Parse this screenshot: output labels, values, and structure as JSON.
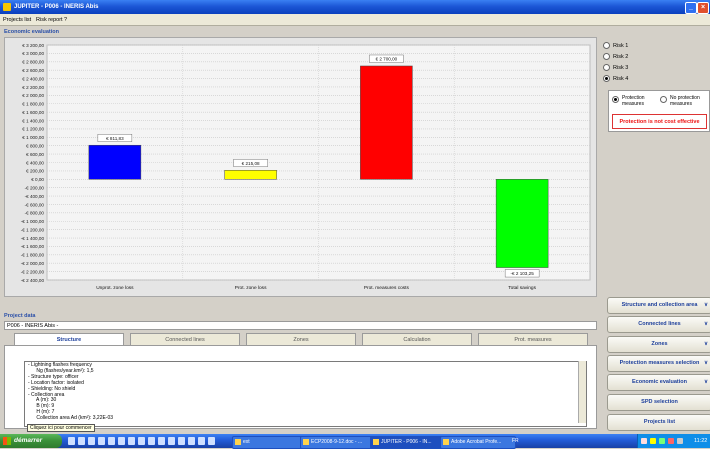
{
  "window": {
    "title": "JUPITER - P006 - INERIS Abis",
    "colors": {
      "title_bar": "#245edb",
      "accent": "#1d3f9b",
      "warning": "#e11111"
    }
  },
  "menu": {
    "items": [
      "Projects list",
      "Risk report",
      "?"
    ]
  },
  "economic_evaluation": {
    "title": "Economic evaluation",
    "chart_data": {
      "type": "bar",
      "title": "",
      "xlabel": "",
      "ylabel": "",
      "ylim": [
        -2400,
        3200
      ],
      "grid": true,
      "yticks": [
        "€ 3 200,00",
        "€ 3 000,00",
        "€ 2 800,00",
        "€ 2 600,00",
        "€ 2 400,00",
        "€ 2 200,00",
        "€ 2 000,00",
        "€ 1 800,00",
        "€ 1 600,00",
        "€ 1 400,00",
        "€ 1 200,00",
        "€ 1 000,00",
        "€ 800,00",
        "€ 600,00",
        "€ 400,00",
        "€ 200,00",
        "€ 0,00",
        "-€ 200,00",
        "-€ 400,00",
        "-€ 600,00",
        "-€ 800,00",
        "-€ 1 000,00",
        "-€ 1 200,00",
        "-€ 1 400,00",
        "-€ 1 600,00",
        "-€ 1 800,00",
        "-€ 2 000,00",
        "-€ 2 200,00",
        "-€ 2 400,00"
      ],
      "categories": [
        "Unprot. zone loss",
        "Prot. zone loss",
        "Prot. measures costs",
        "Total savings"
      ],
      "bars": [
        {
          "start": 0,
          "end": 811.83,
          "label": "€ 811,83",
          "color": "#0000ff"
        },
        {
          "start": 0,
          "end": 215.08,
          "label": "€ 215,08",
          "color": "#ffff00"
        },
        {
          "start": 0,
          "end": 2700.0,
          "label": "€ 2 700,00",
          "color": "#ff0000"
        },
        {
          "start": 0,
          "end": -2103.25,
          "label": "-€ 2 103,25",
          "color": "#00ff00"
        }
      ]
    }
  },
  "risks": {
    "options": [
      "Risk 1",
      "Risk 2",
      "Risk 3",
      "Risk 4"
    ],
    "selected": "Risk 4"
  },
  "protection": {
    "option_protected": "Protection measures",
    "option_unprotected": "No protection measures",
    "selected": "Protection measures",
    "message": "Protection is not cost effective"
  },
  "nav": {
    "items": [
      "Structure and collection area",
      "Connected lines",
      "Zones",
      "Protection measures selection",
      "Economic evaluation",
      "SPD selection",
      "Projects list"
    ]
  },
  "project_data": {
    "title": "Project data",
    "name": "P006 - INERIS Abis -",
    "tabs": [
      "Structure",
      "Connected lines",
      "Zones",
      "Calculation",
      "Prot. measures"
    ],
    "active_tab": "Structure",
    "structure_lines": [
      "- Lightning flashes frequency",
      "      Ng (flashes/year.km²): 1,5",
      "- Structure type: officer",
      "- Location factor: isolated",
      "- Shielding: No shield",
      "- Collection area",
      "      A (m): 30",
      "      B (m): 9",
      "      H (m): 7",
      "      Collection area Ad (km²): 3,22E-03"
    ],
    "tooltip": "Cliquez ici pour commencer"
  },
  "taskbar": {
    "start_label": "démarrer",
    "tasks": [
      "ext",
      "ECP2008-9-12.doc - ...",
      "JUPITER - P006 - IN...",
      "Adobe Acrobat Profe..."
    ],
    "active_task": "JUPITER - P006 - IN...",
    "lang": "FR",
    "clock": "11:22"
  }
}
